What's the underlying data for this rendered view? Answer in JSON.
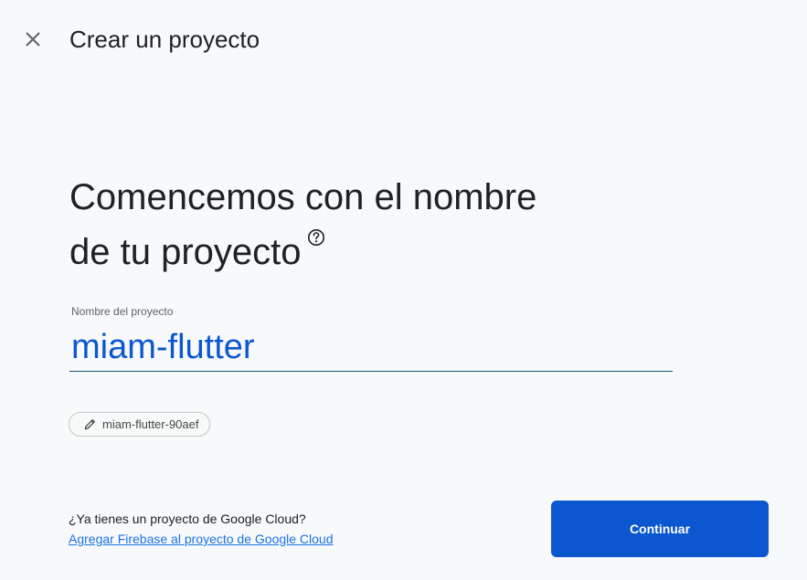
{
  "header": {
    "title": "Crear un proyecto",
    "close_icon": "close-icon"
  },
  "headline": {
    "line1": "Comencemos con el nombre",
    "line2": "de tu proyecto",
    "help_icon": "help-circle-icon"
  },
  "project_name": {
    "label": "Nombre del proyecto",
    "value": "miam-flutter"
  },
  "project_id_chip": {
    "icon": "pencil-icon",
    "label": "miam-flutter-90aef"
  },
  "footer": {
    "question": "¿Ya tienes un proyecto de Google Cloud?",
    "link": "Agregar Firebase al proyecto de Google Cloud",
    "continue_label": "Continuar"
  },
  "colors": {
    "background": "#f8f9fa",
    "accent": "#0b57d0",
    "link": "#1a73e8",
    "text": "#202124"
  }
}
